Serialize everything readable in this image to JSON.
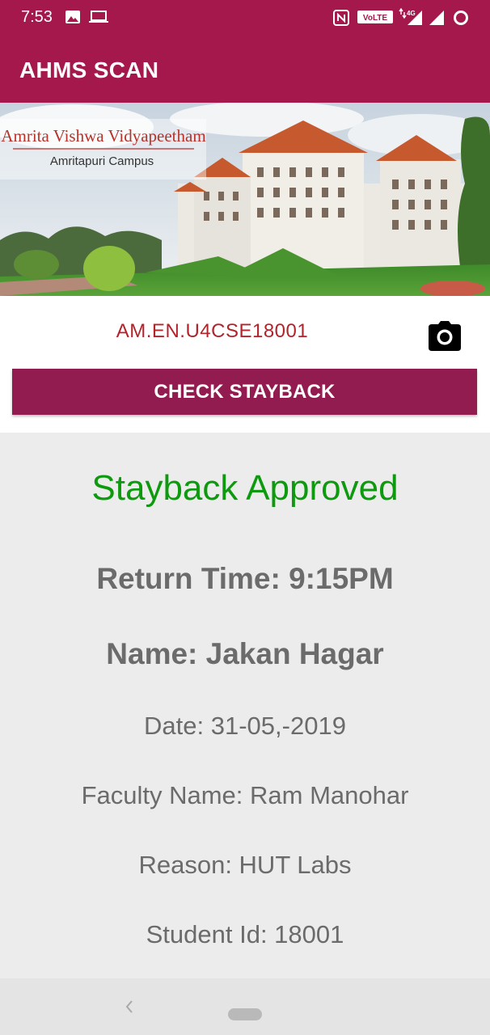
{
  "status_bar": {
    "time": "7:53",
    "icons": [
      "image-icon",
      "laptop-icon",
      "nfc-icon",
      "volte-icon",
      "4g-signal-icon",
      "signal-icon",
      "battery-ring-icon"
    ],
    "volte_label": "VoLTE",
    "network_label": "4G"
  },
  "app_bar": {
    "title": "AHMS SCAN",
    "color": "#a4184b"
  },
  "banner": {
    "institution_name": "Amrita Vishwa Vidyapeetham",
    "campus_name": "Amritapuri Campus"
  },
  "scan": {
    "scanned_code": "AM.EN.U4CSE18001",
    "camera_icon": "camera-icon",
    "check_button_label": "CHECK STAYBACK",
    "button_color": "#921c50"
  },
  "result": {
    "status": "Stayback Approved",
    "status_color": "#0e9a0e",
    "return_time": "Return Time: 9:15PM",
    "name": "Name: Jakan Hagar",
    "date": "Date: 31-05,-2019",
    "faculty_name": "Faculty Name: Ram Manohar",
    "reason": "Reason: HUT Labs",
    "student_id": "Student Id: 18001"
  },
  "nav_bar": {
    "icons": [
      "back-chevron-icon",
      "home-pill-icon"
    ]
  }
}
